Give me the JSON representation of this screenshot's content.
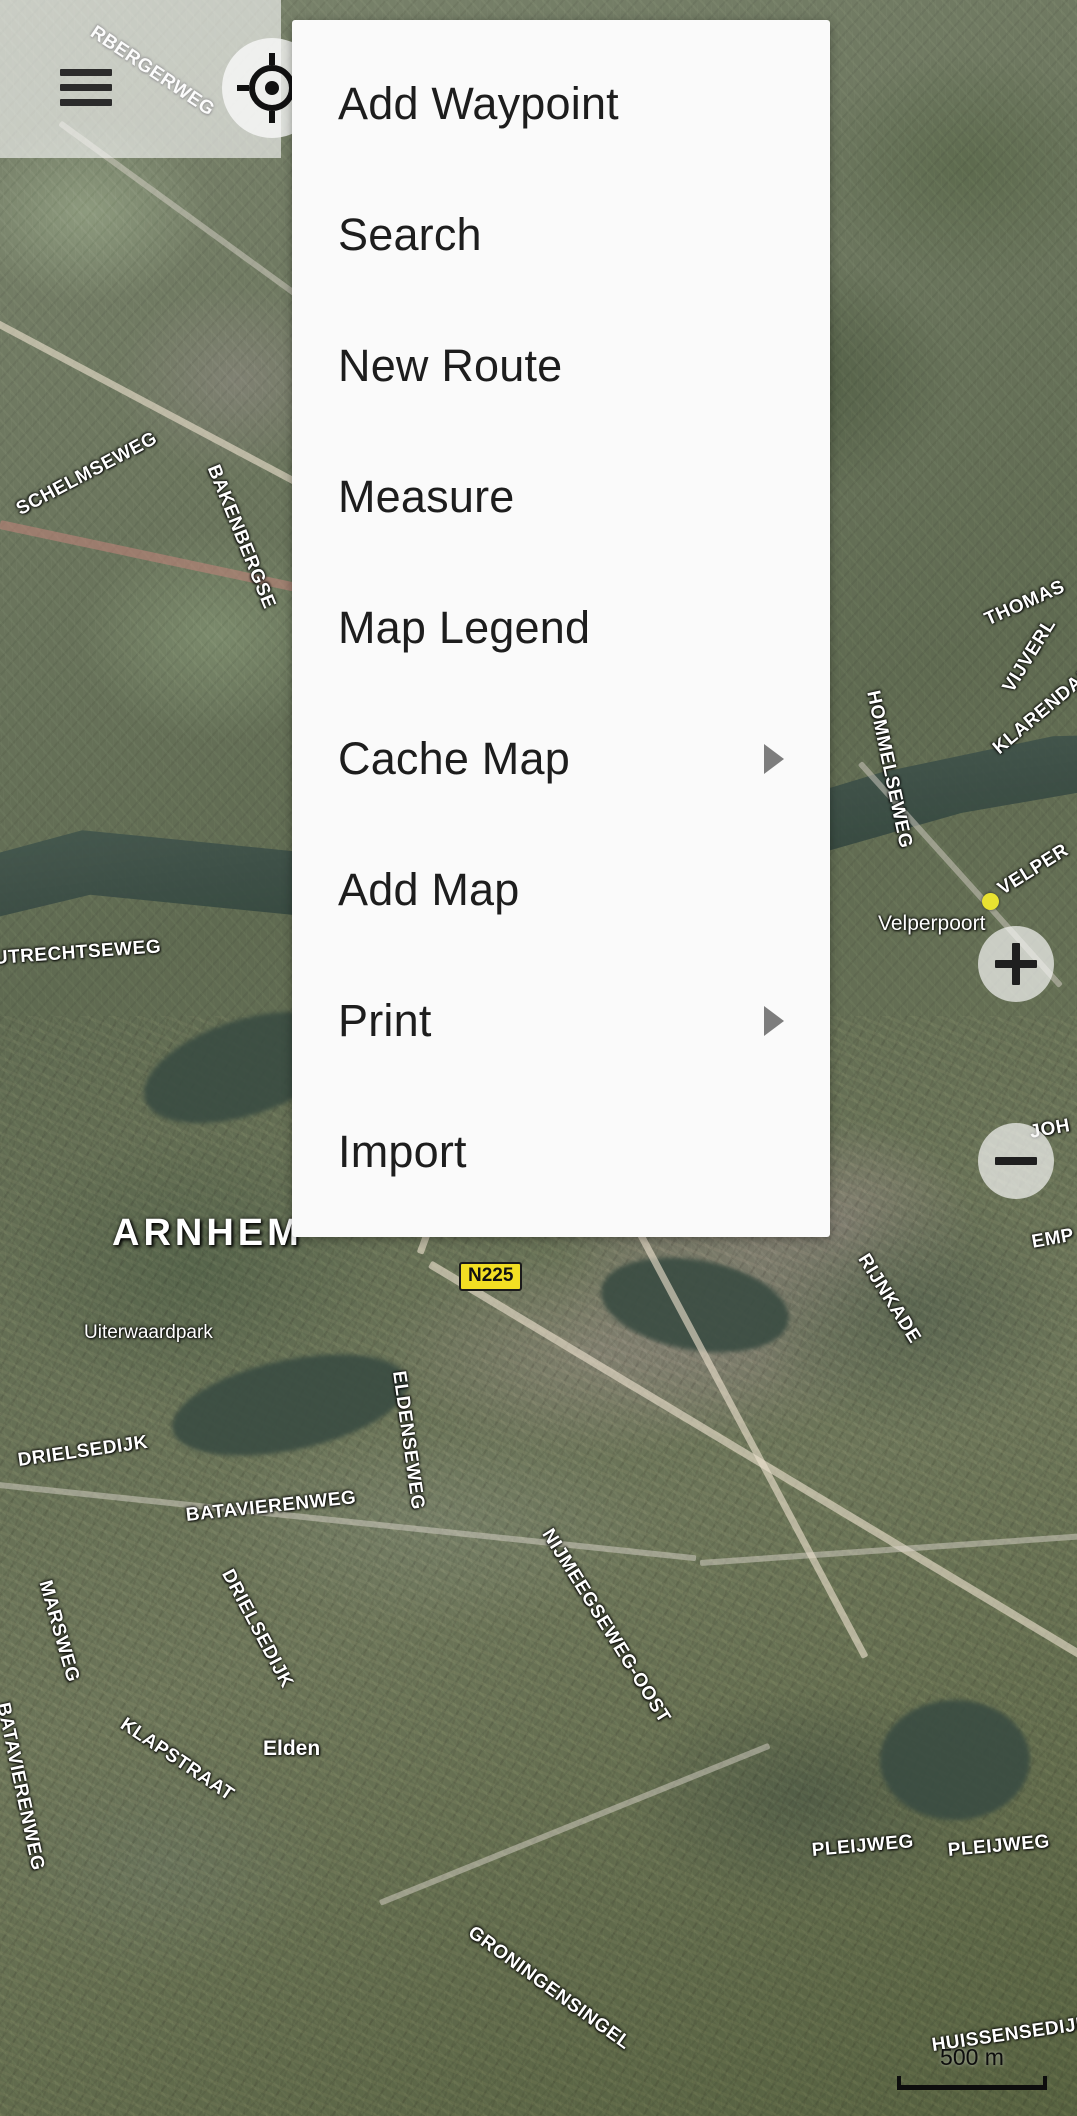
{
  "app": {
    "type": "offline-map-navigation-app",
    "view": "satellite"
  },
  "topbar": {
    "menu_icon": "hamburger-menu-icon",
    "gps_icon": "gps-crosshair-icon"
  },
  "context_menu": {
    "items": [
      {
        "label": "Add Waypoint",
        "has_submenu": false
      },
      {
        "label": "Search",
        "has_submenu": false
      },
      {
        "label": "New Route",
        "has_submenu": false
      },
      {
        "label": "Measure",
        "has_submenu": false
      },
      {
        "label": "Map Legend",
        "has_submenu": false
      },
      {
        "label": "Cache Map",
        "has_submenu": true
      },
      {
        "label": "Add Map",
        "has_submenu": false
      },
      {
        "label": "Print",
        "has_submenu": true
      },
      {
        "label": "Import",
        "has_submenu": false
      }
    ],
    "background_color": "#fafafa",
    "text_color": "#1d1d1d",
    "arrow_color": "#7d7d7d"
  },
  "zoom_controls": {
    "zoom_in_label": "+",
    "zoom_out_label": "−",
    "zoom_in_icon": "plus-icon",
    "zoom_out_icon": "minus-icon"
  },
  "scale_bar": {
    "distance": "500 m"
  },
  "map": {
    "city_label": "ARNHEM",
    "highway_shield": "N225",
    "poi": [
      {
        "name": "Velperpoort",
        "marker_color": "#e8e231"
      }
    ],
    "places": [
      {
        "name": "Uiterwaardpark"
      },
      {
        "name": "Elden"
      }
    ],
    "streets": [
      "RBERGERWEG",
      "SCHELMSEWEG",
      "BAKENBERGSE",
      "UTRECHTSEWEG",
      "THOMAS",
      "VIJVERL",
      "HOMMELSEWEG",
      "KLARENDAL",
      "VELPER",
      "RIJNKADE",
      "JOH",
      "EMP",
      "DRIELSEDIJK",
      "BATAVIERENWEG",
      "DRIELSEDIJK",
      "ELDENSEWEG",
      "NIJMEEGSEWEG-OOST",
      "KLAPSTRAAT",
      "BATAVIERENWEG",
      "MARSWEG",
      "PLEIJWEG",
      "PLEIJWEG",
      "GRONINGENSINGEL",
      "HUISSENSEDIJK"
    ]
  }
}
